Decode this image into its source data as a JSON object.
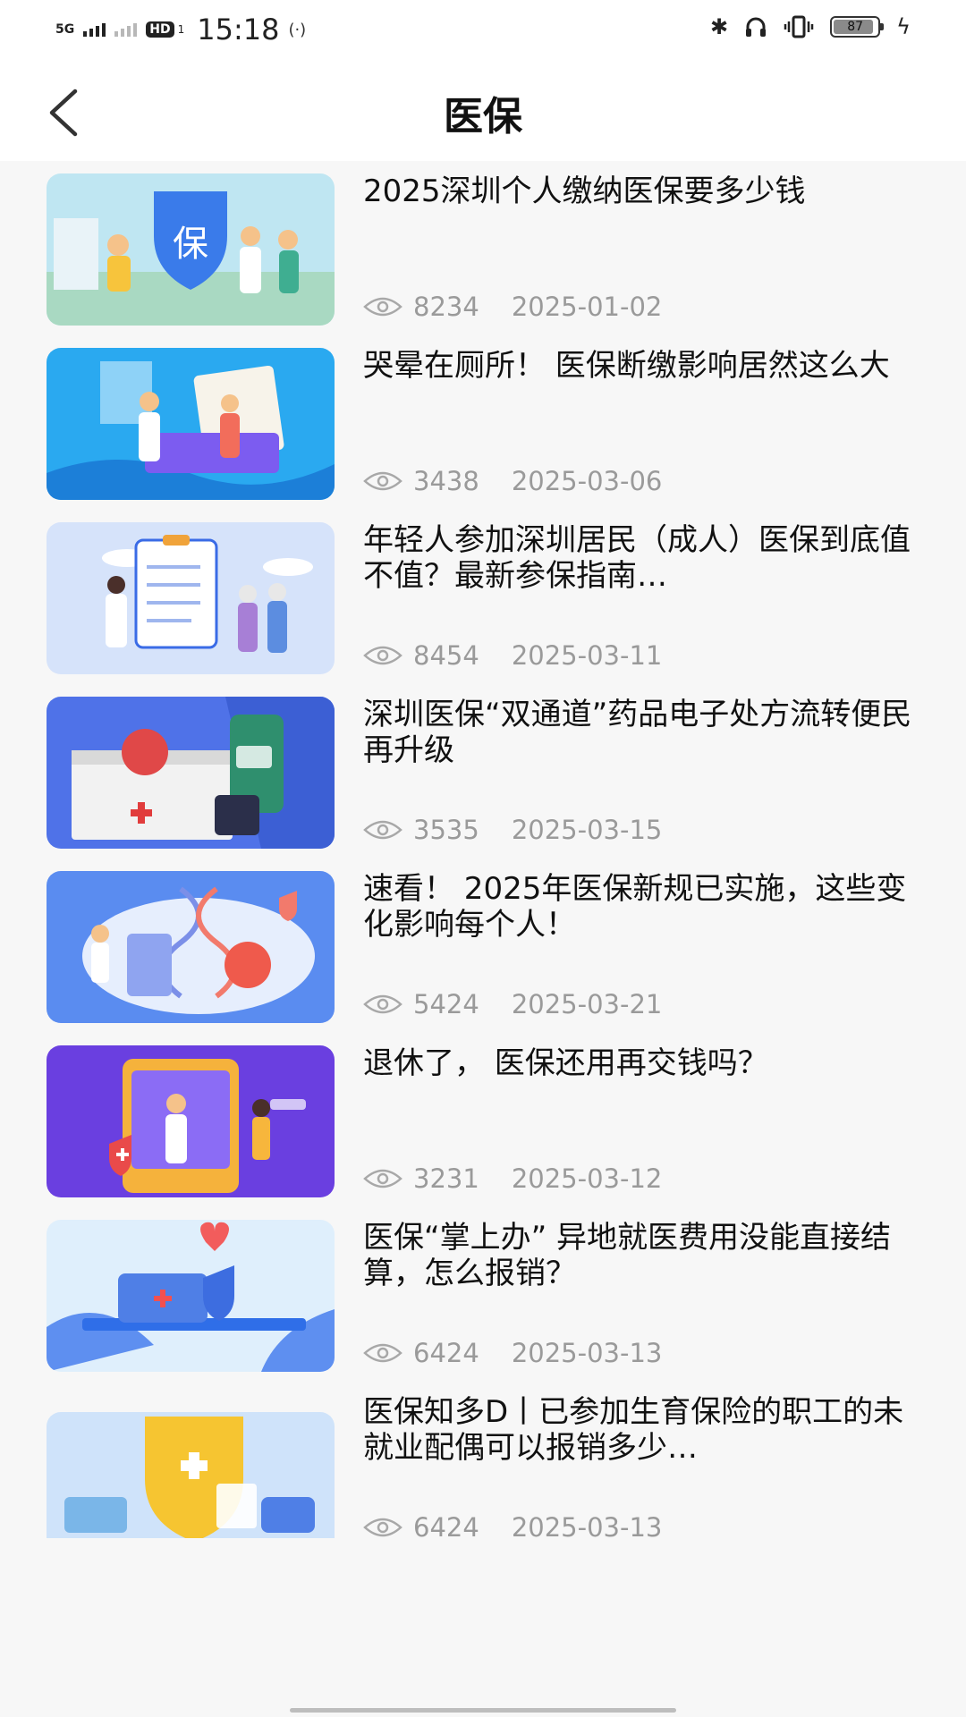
{
  "status_bar": {
    "network": "5G",
    "hd": "HD",
    "hd_sub": "1",
    "time": "15:18",
    "battery": "87"
  },
  "header": {
    "title": "医保"
  },
  "articles": [
    {
      "title": "2025深圳个人缴纳医保要多少钱",
      "views": "8234",
      "date": "2025-01-02",
      "thumb_bg": "#bfe6f2",
      "thumb_accent": "#3a7bea"
    },
    {
      "title": "哭晕在厕所！ 医保断缴影响居然这么大",
      "views": "3438",
      "date": "2025-03-06",
      "thumb_bg": "#2aa9f0",
      "thumb_accent": "#7c5cf0"
    },
    {
      "title": "年轻人参加深圳居民（成人）医保到底值不值？最新参保指南…",
      "views": "8454",
      "date": "2025-03-11",
      "thumb_bg": "#d6e3fa",
      "thumb_accent": "#f0a33a"
    },
    {
      "title": "深圳医保“双通道”药品电子处方流转便民再升级",
      "views": "3535",
      "date": "2025-03-15",
      "thumb_bg": "#4f72e8",
      "thumb_accent": "#f2f2f2"
    },
    {
      "title": "速看！ 2025年医保新规已实施，这些变化影响每个人！",
      "views": "5424",
      "date": "2025-03-21",
      "thumb_bg": "#5a8cf0",
      "thumb_accent": "#ef5a4c"
    },
    {
      "title": "退休了， 医保还用再交钱吗？",
      "views": "3231",
      "date": "2025-03-12",
      "thumb_bg": "#6a3fe0",
      "thumb_accent": "#f5b23c"
    },
    {
      "title": "医保“掌上办” 异地就医费用没能直接结算，怎么报销？",
      "views": "6424",
      "date": "2025-03-13",
      "thumb_bg": "#dfeffc",
      "thumb_accent": "#2f6ee8"
    },
    {
      "title": "医保知多D丨已参加生育保险的职工的未就业配偶可以报销多少…",
      "views": "6424",
      "date": "2025-03-13",
      "thumb_bg": "#cfe3fa",
      "thumb_accent": "#f6c531"
    }
  ]
}
